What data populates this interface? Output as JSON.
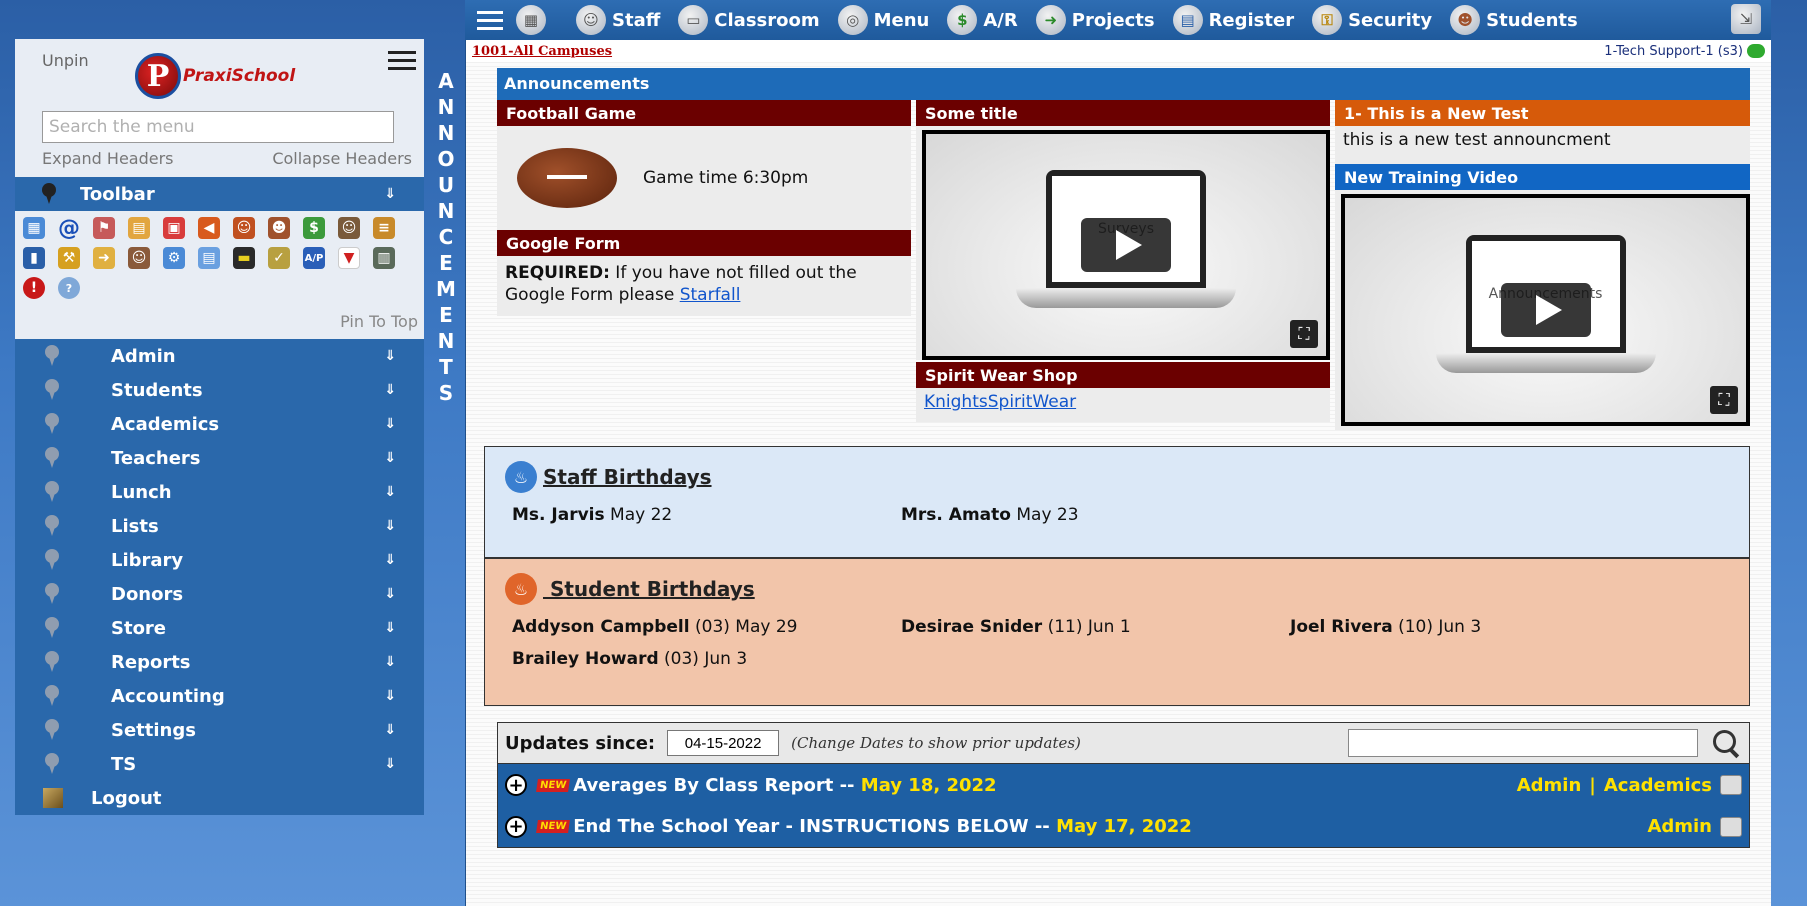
{
  "topnav": {
    "items": [
      {
        "label": "Staff",
        "icon": "staff-icon"
      },
      {
        "label": "Classroom",
        "icon": "classroom-icon"
      },
      {
        "label": "Menu",
        "icon": "menu-icon"
      },
      {
        "label": "A/R",
        "icon": "money-icon"
      },
      {
        "label": "Projects",
        "icon": "arrow-right-icon"
      },
      {
        "label": "Register",
        "icon": "register-icon"
      },
      {
        "label": "Security",
        "icon": "key-icon"
      },
      {
        "label": "Students",
        "icon": "student-icon"
      }
    ]
  },
  "header": {
    "campus": "1001-All Campuses",
    "user": "1-Tech Support-1 (s3)"
  },
  "sidebar": {
    "unpin": "Unpin",
    "logo_letter": "P",
    "logo_text": "PraxiSchool",
    "search_placeholder": "Search the menu",
    "expand": "Expand Headers",
    "collapse": "Collapse Headers",
    "toolbar_label": "Toolbar",
    "pin_to_top": "Pin To Top",
    "items": [
      {
        "label": "Admin"
      },
      {
        "label": "Students"
      },
      {
        "label": "Academics"
      },
      {
        "label": "Teachers"
      },
      {
        "label": "Lunch"
      },
      {
        "label": "Lists"
      },
      {
        "label": "Library"
      },
      {
        "label": "Donors"
      },
      {
        "label": "Store"
      },
      {
        "label": "Reports"
      },
      {
        "label": "Accounting"
      },
      {
        "label": "Settings"
      },
      {
        "label": "TS"
      }
    ],
    "logout": "Logout",
    "arrow": "⇓"
  },
  "vertical_label": "ANNOUNCEMENTS",
  "announcements": {
    "header": "Announcements",
    "football": {
      "title": "Football Game",
      "text": "Game time 6:30pm"
    },
    "google_form": {
      "title": "Google Form",
      "bold": "REQUIRED:",
      "text": " If you have not filled out the Google Form please ",
      "link": "Starfall"
    },
    "some_title": {
      "title": "Some title",
      "video_caption": "Surveys"
    },
    "spirit": {
      "title": "Spirit Wear Shop",
      "link": "KnightsSpiritWear"
    },
    "new_test": {
      "title": "1- This is a New Test",
      "text": "this is a new test announcment"
    },
    "training": {
      "title": "New Training Video",
      "video_caption": "Announcements"
    }
  },
  "staff_birthdays": {
    "title": "Staff Birthdays",
    "people": [
      {
        "name": "Ms. Jarvis",
        "date": "May 22"
      },
      {
        "name": "Mrs. Amato",
        "date": "May 23"
      }
    ]
  },
  "student_birthdays": {
    "title": " Student Birthdays",
    "people": [
      {
        "name": "Addyson Campbell",
        "date": "(03) May 29"
      },
      {
        "name": "Desirae Snider",
        "date": "(11) Jun 1"
      },
      {
        "name": "Joel Rivera",
        "date": "(10) Jun 3"
      },
      {
        "name": "Brailey Howard",
        "date": "(03) Jun 3"
      }
    ]
  },
  "updates": {
    "label": "Updates since:",
    "date": "04-15-2022",
    "hint": "(Change Dates to show prior updates)",
    "new_badge": "NEW",
    "rows": [
      {
        "title": "Averages By Class Report -- ",
        "date": "May 18, 2022",
        "tags": [
          "Admin",
          "|",
          "Academics"
        ]
      },
      {
        "title": "End The School Year - INSTRUCTIONS BELOW -- ",
        "date": "May 17, 2022",
        "tags": [
          "Admin"
        ]
      }
    ]
  }
}
